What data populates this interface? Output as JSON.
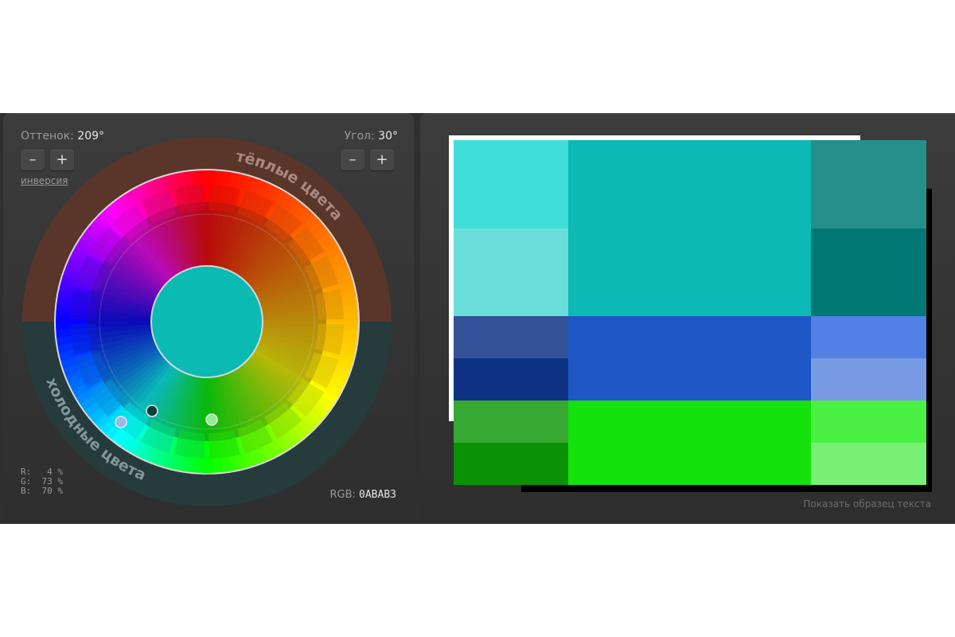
{
  "wheel": {
    "hue_label": "Оттенок:",
    "hue_value": "209°",
    "angle_label": "Угол:",
    "angle_value": "30°",
    "minus": "–",
    "plus": "+",
    "invert_link": "инверсия",
    "warm_label": "тёплые цвета",
    "cold_label": "холодные цвета",
    "rgb_r": "R:   4 %",
    "rgb_g": "G:  73 %",
    "rgb_b": "B:  70 %",
    "rgb_label": "RGB:",
    "rgb_hex": "0ABAB3",
    "center_color": "#0ABAB3",
    "markers": [
      {
        "name": "marker-blue",
        "color": "#9fb3ec"
      },
      {
        "name": "marker-dark",
        "color": "#0c3f3a"
      },
      {
        "name": "marker-green",
        "color": "#8ff08f"
      }
    ]
  },
  "palette": {
    "show_text_link": "Показать образец текста",
    "colors": {
      "primary_main": "#0CB9B4",
      "primary_light1": "#40DED9",
      "primary_light2": "#6ADED9",
      "primary_dark1": "#268F8A",
      "primary_dark2": "#007874",
      "sec1_main": "#1F56C6",
      "sec1_dark1": "#345297",
      "sec1_dark2": "#0E3384",
      "sec1_light1": "#5181E4",
      "sec1_light2": "#789BE4",
      "sec2_main": "#15E20C",
      "sec2_dark1": "#37A933",
      "sec2_dark2": "#0A9204",
      "sec2_light1": "#4AF043",
      "sec2_light2": "#78F073"
    }
  }
}
